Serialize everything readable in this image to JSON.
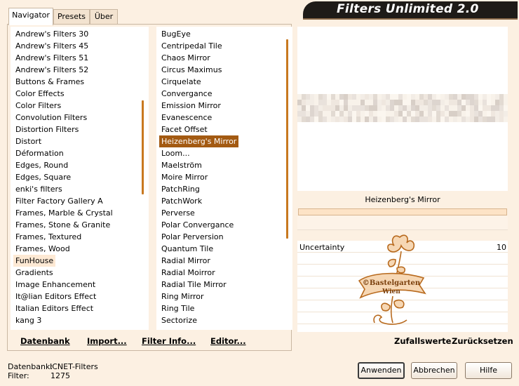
{
  "app": {
    "title": "Filters Unlimited 2.0"
  },
  "tabs": [
    {
      "label": "Navigator",
      "active": true
    },
    {
      "label": "Presets",
      "active": false
    },
    {
      "label": "Über",
      "active": false
    }
  ],
  "categories": {
    "items": [
      "Andrew's Filters 30",
      "Andrew's Filters 45",
      "Andrew's Filters 51",
      "Andrew's Filters 52",
      "Buttons & Frames",
      "Color Effects",
      "Color Filters",
      "Convolution Filters",
      "Distortion Filters",
      "Distort",
      "Déformation",
      "Edges, Round",
      "Edges, Square",
      "enki's filters",
      "Filter Factory Gallery A",
      "Frames, Marble & Crystal",
      "Frames, Stone & Granite",
      "Frames, Textured",
      "Frames, Wood",
      "FunHouse",
      "Gradients",
      "Image Enhancement",
      "It@lian Editors Effect",
      "Italian Editors Effect",
      "kang 3"
    ],
    "hovered": "FunHouse"
  },
  "filters": {
    "items": [
      "BugEye",
      "Centripedal Tile",
      "Chaos Mirror",
      "Circus Maximus",
      "Cirquelate",
      "Convergance",
      "Emission Mirror",
      "Evanescence",
      "Facet Offset",
      "Heizenberg's Mirror",
      "Loom...",
      "Maelström",
      "Moire Mirror",
      "PatchRing",
      "PatchWork",
      "Perverse",
      "Polar Convergance",
      "Polar Perversion",
      "Quantum Tile",
      "Radial Mirror",
      "Radial Moirror",
      "Radial Tile Mirror",
      "Ring Mirror",
      "Ring Tile",
      "Sectorize"
    ],
    "selected": "Heizenberg's Mirror"
  },
  "left_actions": {
    "database": "Datenbank",
    "import": "Import...",
    "filter_info": "Filter Info...",
    "editor": "Editor..."
  },
  "preview": {
    "filter_name": "Heizenberg's Mirror"
  },
  "parameters": [
    {
      "label": "Uncertainty",
      "value": "10"
    }
  ],
  "watermark": {
    "line1": "©Bastelgarten",
    "line2": "Wien"
  },
  "right_actions": {
    "random": "Zufallswerte",
    "reset": "Zurücksetzen"
  },
  "status": {
    "database_label": "Datenbank:",
    "database_value": "ICNET-Filters",
    "filter_label": "Filter:",
    "filter_value": "1275"
  },
  "buttons": {
    "apply": "Anwenden",
    "cancel": "Abbrechen",
    "help": "Hilfe"
  },
  "colors": {
    "accent": "#a35a12",
    "scrollbar": "#c8781f",
    "background": "#fcf0e2",
    "banner": "#1e1b18"
  }
}
